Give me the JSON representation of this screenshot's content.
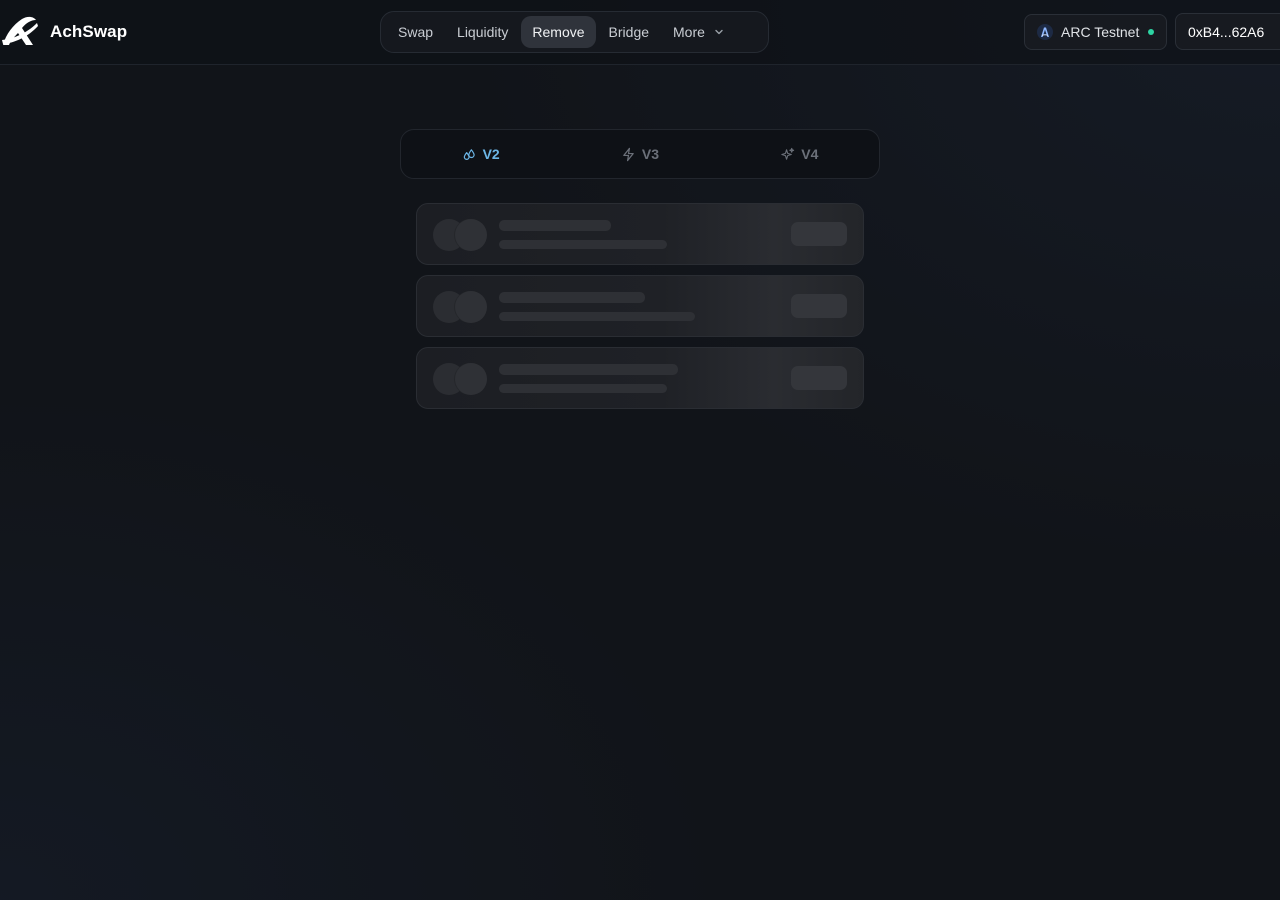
{
  "brand": {
    "name": "AchSwap"
  },
  "nav": {
    "items": [
      {
        "label": "Swap",
        "active": false
      },
      {
        "label": "Liquidity",
        "active": false
      },
      {
        "label": "Remove",
        "active": true
      },
      {
        "label": "Bridge",
        "active": false
      },
      {
        "label": "More",
        "active": false,
        "has_dropdown": true
      }
    ]
  },
  "network": {
    "label": "ARC Testnet",
    "status_color": "#2dd4a3",
    "icon": "arc-network-icon"
  },
  "wallet": {
    "address": "0xB4...62A6"
  },
  "version_tabs": [
    {
      "label": "V2",
      "icon": "droplets-icon",
      "active": true
    },
    {
      "label": "V3",
      "icon": "zap-icon",
      "active": false
    },
    {
      "label": "V4",
      "icon": "sparkles-icon",
      "active": false
    }
  ],
  "loading_positions": {
    "skeleton_count": 3
  },
  "colors": {
    "background": "#111419",
    "active_tab": "#6cb6e6",
    "active_nav_bg": "#2f333b"
  }
}
